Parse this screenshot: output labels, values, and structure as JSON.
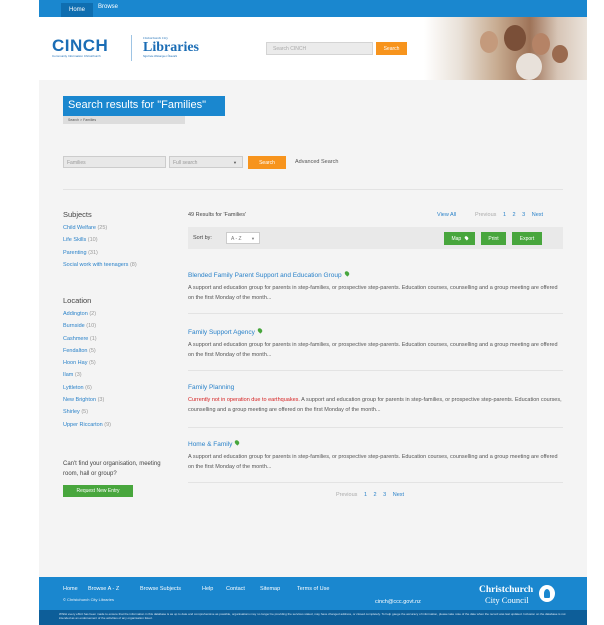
{
  "topnav": {
    "home": "Home",
    "browse": "Browse"
  },
  "header": {
    "cinch": "CINCH",
    "cinch_sub": "Community Information Christchurch",
    "lib_small": "Christchurch City",
    "libraries": "Libraries",
    "lib_tag": "Ngā Kete Wānanga o Ōtautahi",
    "search_placeholder": "Search CINCH",
    "search_button": "Search"
  },
  "results_title": "Search results for \"Families\"",
  "breadcrumb": "Search > Families",
  "search": {
    "query": "Families",
    "mode": "Full search",
    "button": "Search",
    "advanced": "Advanced Search"
  },
  "sidebar": {
    "subjects_heading": "Subjects",
    "subjects": [
      {
        "label": "Child Welfare",
        "count": "(25)"
      },
      {
        "label": "Life Skills",
        "count": "(10)"
      },
      {
        "label": "Parenting",
        "count": "(31)"
      },
      {
        "label": "Social work with teenagers",
        "count": "(8)"
      }
    ],
    "location_heading": "Location",
    "locations": [
      {
        "label": "Addington",
        "count": "(2)"
      },
      {
        "label": "Burnside",
        "count": "(10)"
      },
      {
        "label": "Cashmere",
        "count": "(1)"
      },
      {
        "label": "Fendalton",
        "count": "(5)"
      },
      {
        "label": "Hoon Hay",
        "count": "(5)"
      },
      {
        "label": "Ilam",
        "count": "(3)"
      },
      {
        "label": "Lyttleton",
        "count": "(6)"
      },
      {
        "label": "New Brighton",
        "count": "(3)"
      },
      {
        "label": "Shirley",
        "count": "(5)"
      },
      {
        "label": "Upper Riccarton",
        "count": "(9)"
      }
    ],
    "cant_find": "Can't find your organisation, meeting room, hall or group?",
    "request_button": "Request New Entry"
  },
  "results": {
    "count_text": "49 Results for 'Families'",
    "view_all": "View All",
    "pager": {
      "previous": "Previous",
      "pages": [
        "1",
        "2",
        "3"
      ],
      "next": "Next"
    },
    "sort_label": "Sort by:",
    "sort_value": "A - Z",
    "map_button": "Map",
    "print_button": "Print",
    "export_button": "Export",
    "items": [
      {
        "title": "Blended Family Parent Support and Education Group",
        "warning": "",
        "desc": "A support and education group for parents in step-families, or prospective step-parents. Education courses, counselling and a group meeting are offered on the first Monday of the month..."
      },
      {
        "title": "Family Support Agency",
        "warning": "",
        "desc": "A support and education group for parents in step-families, or prospective step-parents. Education courses, counselling and a group meeting are offered on the first Monday of the month..."
      },
      {
        "title": "Family Planning",
        "warning": "Currently not in operation due to earthquakes.",
        "desc": "A support and education group for parents in step-families, or prospective step-parents. Education courses, counselling and a group meeting are offered on the first Monday of the month..."
      },
      {
        "title": "Home & Family",
        "warning": "",
        "desc": "A support and education group for parents in step-families, or prospective step-parents. Education courses, counselling and a group meeting are offered on the first Monday of the month..."
      }
    ]
  },
  "footer": {
    "links": [
      "Home",
      "Browse A - Z",
      "Browse Subjects",
      "Help",
      "Contact",
      "Sitemap",
      "Terms of Use"
    ],
    "copyright": "© Christchurch City Libraries",
    "email": "cinch@ccc.govt.nz",
    "council_line1": "Christchurch",
    "council_line2": "City Council",
    "disclaimer": "Whilst every effort has been made to ensure that the information in this database is as up to date and comprehensive as possible, organisations may no longer be providing the services stated, may have changed address, or closed completely. To help gauge the accuracy of information, please take note of the date when the record was last updated. Inclusion on the database is not intended as an endorsement of the activities of any organisation listed."
  },
  "colors": {
    "brand_blue": "#1a87cf",
    "orange": "#f7941d",
    "green": "#48a63d",
    "warning_red": "#d62222"
  }
}
